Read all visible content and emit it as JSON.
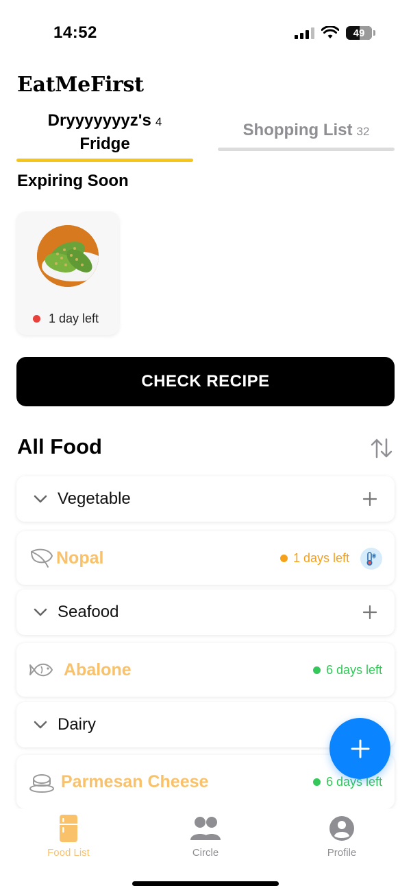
{
  "status_bar": {
    "time": "14:52",
    "battery": "49"
  },
  "app": {
    "title": "EatMeFirst"
  },
  "tabs": {
    "fridge": {
      "label": "Dryyyyyyyz's",
      "label_line2": "Fridge",
      "count": "4"
    },
    "shopping": {
      "label": "Shopping List",
      "count": "32"
    }
  },
  "expiring": {
    "heading": "Expiring Soon",
    "cards": [
      {
        "status": "1 day left",
        "status_color": "#e8413b"
      }
    ]
  },
  "check_recipe_label": "CHECK RECIPE",
  "all_food": {
    "heading": "All Food",
    "categories": [
      {
        "label": "Vegetable",
        "items": [
          {
            "name": "Nopal",
            "icon": "leaf-icon",
            "status": "1 days left",
            "status_color": "#f5a11c",
            "storage": "freezer-thermometer-icon"
          }
        ]
      },
      {
        "label": "Seafood",
        "items": [
          {
            "name": "Abalone",
            "icon": "fish-icon",
            "status": "6 days left",
            "status_color": "#34c759"
          }
        ]
      },
      {
        "label": "Dairy",
        "items": [
          {
            "name": "Parmesan Cheese",
            "icon": "cheese-icon",
            "status": "6 days left",
            "status_color": "#34c759"
          }
        ]
      }
    ]
  },
  "tabbar": {
    "items": [
      {
        "label": "Food List",
        "icon": "fridge-icon",
        "active": true
      },
      {
        "label": "Circle",
        "icon": "people-icon",
        "active": false
      },
      {
        "label": "Profile",
        "icon": "person-icon",
        "active": false
      }
    ]
  },
  "colors": {
    "accent": "#f5c518",
    "fab": "#0a84ff",
    "item_name": "#f8c16a"
  }
}
